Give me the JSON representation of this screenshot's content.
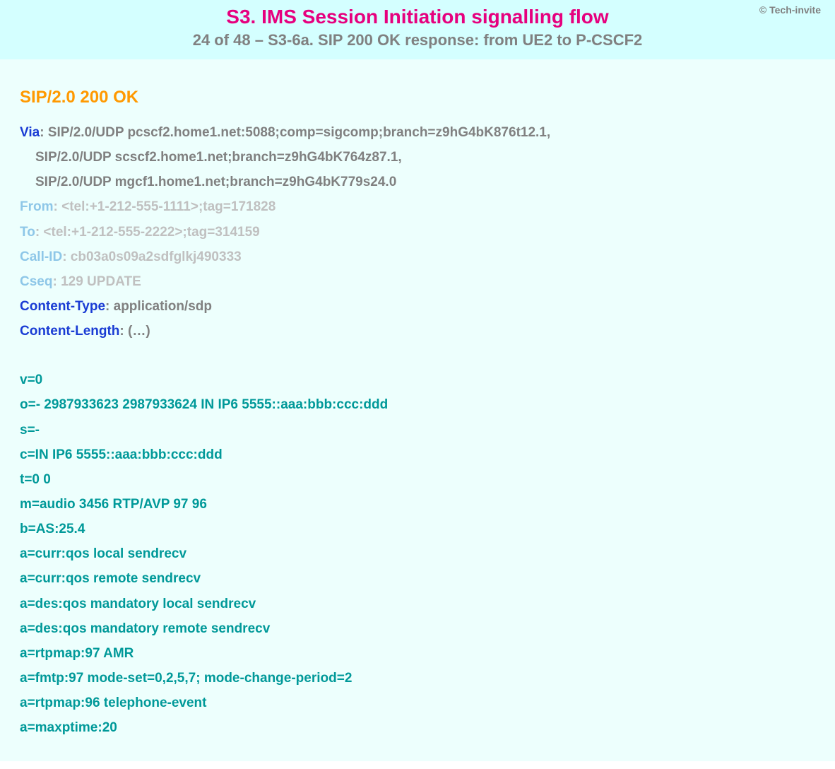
{
  "copyright": "© Tech-invite",
  "title": "S3. IMS Session Initiation signalling flow",
  "subtitle": "24 of 48 – S3-6a. SIP 200 OK response: from UE2 to P-CSCF2",
  "status": "SIP/2.0 200 OK",
  "headers": [
    {
      "key": "Via",
      "keyStyle": "dark",
      "valStyle": "dark",
      "val": ": SIP/2.0/UDP pcscf2.home1.net:5088;comp=sigcomp;branch=z9hG4bK876t12.1,"
    },
    {
      "key": "",
      "keyStyle": "dark",
      "valStyle": "dark",
      "val": "SIP/2.0/UDP scscf2.home1.net;branch=z9hG4bK764z87.1,",
      "indent": true
    },
    {
      "key": "",
      "keyStyle": "dark",
      "valStyle": "dark",
      "val": "SIP/2.0/UDP mgcf1.home1.net;branch=z9hG4bK779s24.0",
      "indent": true
    },
    {
      "key": "From",
      "keyStyle": "light",
      "valStyle": "light",
      "val": ": <tel:+1-212-555-1111>;tag=171828"
    },
    {
      "key": "To",
      "keyStyle": "light",
      "valStyle": "light",
      "val": ": <tel:+1-212-555-2222>;tag=314159"
    },
    {
      "key": "Call-ID",
      "keyStyle": "light",
      "valStyle": "light",
      "val": ": cb03a0s09a2sdfglkj490333"
    },
    {
      "key": "Cseq",
      "keyStyle": "light",
      "valStyle": "light",
      "val": ": 129 UPDATE"
    },
    {
      "key": "Content-Type",
      "keyStyle": "dark",
      "valStyle": "dark",
      "val": ": application/sdp"
    },
    {
      "key": "Content-Length",
      "keyStyle": "dark",
      "valStyle": "dark",
      "val": ": (…)"
    }
  ],
  "sdp": [
    "v=0",
    "o=- 2987933623 2987933624 IN IP6 5555::aaa:bbb:ccc:ddd",
    "s=-",
    "c=IN IP6 5555::aaa:bbb:ccc:ddd",
    "t=0 0",
    "m=audio 3456 RTP/AVP 97 96",
    "b=AS:25.4",
    "a=curr:qos local sendrecv",
    "a=curr:qos remote sendrecv",
    "a=des:qos mandatory local sendrecv",
    "a=des:qos mandatory remote sendrecv",
    "a=rtpmap:97 AMR",
    "a=fmtp:97 mode-set=0,2,5,7; mode-change-period=2",
    "a=rtpmap:96 telephone-event",
    "a=maxptime:20"
  ]
}
